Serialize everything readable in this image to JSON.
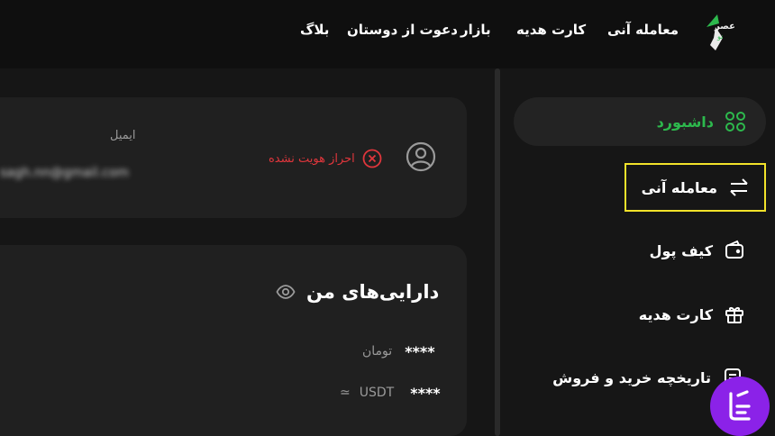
{
  "nav": {
    "logo_text": "عصر",
    "logo_sub": "نو",
    "items": [
      "معامله آنی",
      "کارت هدیه",
      "بازار",
      "دعوت از دوستان",
      "بلاگ"
    ]
  },
  "sidebar": {
    "items": [
      {
        "label": "داشبورد",
        "icon": "grid-icon"
      },
      {
        "label": "معامله آنی",
        "icon": "swap-arrows-icon"
      },
      {
        "label": "کیف پول",
        "icon": "wallet-icon"
      },
      {
        "label": "کارت هدیه",
        "icon": "gift-icon"
      },
      {
        "label": "تاریخچه خرید و فروش",
        "icon": "history-icon"
      }
    ]
  },
  "profile": {
    "email_label": "ایمیل",
    "email_value": "sagh.nn@gmail.com",
    "verify_status": "احراز هویت نشده"
  },
  "assets": {
    "title": "دارایی‌های من",
    "toman_mask": "****",
    "toman_unit": "تومان",
    "usdt_mask": "****",
    "usdt_unit": "USDT",
    "approx_symbol": "≃"
  },
  "colors": {
    "accent": "#2db94d",
    "danger": "#e0363c",
    "highlight": "#f2e22a",
    "background": "#161616",
    "card": "#202020"
  }
}
